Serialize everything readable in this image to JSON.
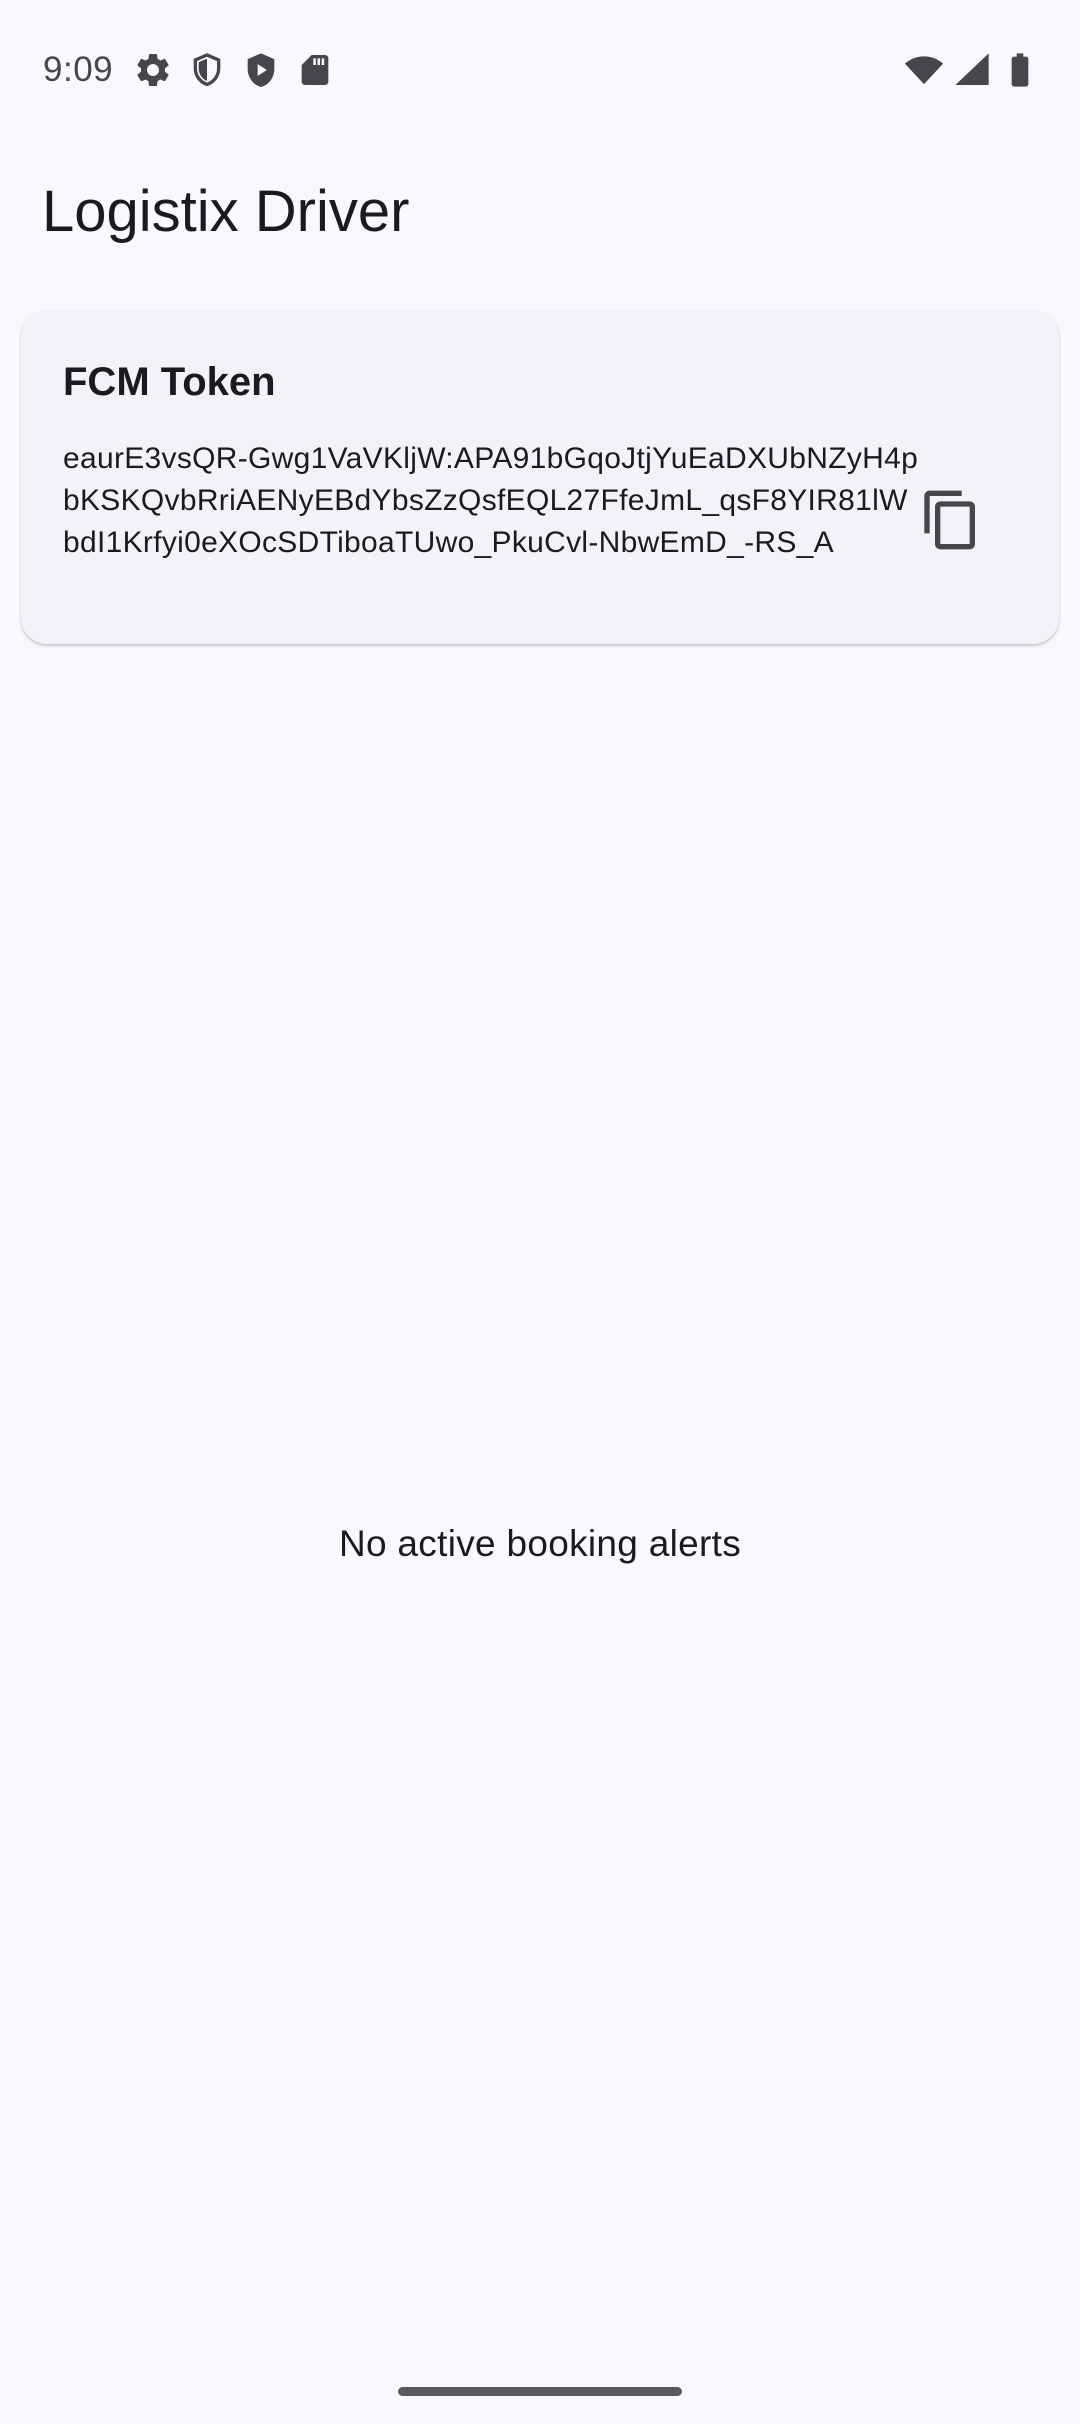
{
  "status_bar": {
    "time": "9:09",
    "left_icons": [
      "gear-icon",
      "shield-outline-icon",
      "shield-play-icon",
      "sd-card-icon"
    ],
    "right_icons": [
      "wifi-icon",
      "cell-signal-icon",
      "battery-icon"
    ]
  },
  "app_bar": {
    "title": "Logistix Driver"
  },
  "token_card": {
    "title": "FCM Token",
    "token": "eaurE3vsQR-Gwg1VaVKljW:APA91bGqoJtjYuEaDXUbNZyH4pbKSKQvbRriAENyEBdYbsZzQsfEQL27FfeJmL_qsF8YIR81lWbdI1Krfyi0eXOcSDTiboaTUwo_PkuCvl-NbwEmD_-RS_A",
    "copy_icon": "copy-icon"
  },
  "main": {
    "empty_message": "No active booking alerts"
  },
  "colors": {
    "background": "#f8f9fe",
    "card_background": "#f2f3f8",
    "text_primary": "#1b1b1f",
    "status_icons": "#45474b",
    "nav_handle": "#5a5b60"
  }
}
